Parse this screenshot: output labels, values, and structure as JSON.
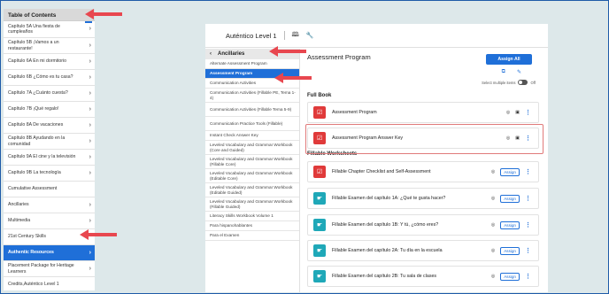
{
  "toc": {
    "title": "Table of Contents",
    "items": [
      {
        "label": "Capítulo 5A Una fiesta de cumpleaños",
        "state": "mark"
      },
      {
        "label": "Capítulo 5B ¡Vamos a un restaurante!",
        "state": ""
      },
      {
        "label": "Capítulo 6A En mi dormitorio",
        "state": ""
      },
      {
        "label": "Capítulo 6B ¿Cómo es tu casa?",
        "state": ""
      },
      {
        "label": "Capítulo 7A ¿Cuánto cuesta?",
        "state": ""
      },
      {
        "label": "Capítulo 7B ¡Qué regalo!",
        "state": ""
      },
      {
        "label": "Capítulo 8A De vacaciones",
        "state": ""
      },
      {
        "label": "Capítulo 8B Ayudando en la comunidad",
        "state": ""
      },
      {
        "label": "Capítulo 9A El cine y la televisión",
        "state": ""
      },
      {
        "label": "Capítulo 9B La tecnología",
        "state": ""
      },
      {
        "label": "Cumulative Assessment",
        "state": "nochev"
      },
      {
        "label": "Ancillaries",
        "state": ""
      },
      {
        "label": "Multimedia",
        "state": ""
      },
      {
        "label": "21st Century Skills",
        "state": "nochev"
      },
      {
        "label": "Authentic Resources",
        "state": "active"
      },
      {
        "label": "Placement Package for Heritage Learners",
        "state": ""
      },
      {
        "label": "Credits,Auténtico Level 1",
        "state": "nochev"
      }
    ]
  },
  "app": {
    "title": "Auténtico Level 1",
    "book_icon": "book-icon",
    "wrench_icon": "wrench-icon",
    "sidebar": {
      "back_label": "Ancillaries",
      "items": [
        {
          "label": "Alternate Assessment Program",
          "active": false
        },
        {
          "label": "Assessment Program",
          "active": true
        },
        {
          "label": "Communication Activities",
          "active": false
        },
        {
          "label": "Communication Activities (Fillable PE, Tema 1-4)",
          "active": false
        },
        {
          "label": "Communication Activities (Fillable Tema 5-9)",
          "active": false
        },
        {
          "label": "Communication Practice Tools (Fillable)",
          "active": false
        },
        {
          "label": "Instant Check Answer Key",
          "active": false
        },
        {
          "label": "Leveled Vocabulary and Grammar Workbook (Core and Guided)",
          "active": false
        },
        {
          "label": "Leveled Vocabulary and Grammar Workbook (Fillable Core)",
          "active": false
        },
        {
          "label": "Leveled Vocabulary and Grammar Workbook (Editable Core)",
          "active": false
        },
        {
          "label": "Leveled Vocabulary and Grammar Workbook (Editable Guided)",
          "active": false
        },
        {
          "label": "Leveled Vocabulary and Grammar Workbook (Fillable Guided)",
          "active": false
        },
        {
          "label": "Literacy Skills Workbook Volume 1",
          "active": false
        },
        {
          "label": "Para hispanohablantes",
          "active": false
        },
        {
          "label": "Para el Examen",
          "active": false
        }
      ]
    },
    "content": {
      "title": "Assessment Program",
      "assign_all": "Assign All",
      "select_multiple": "Select multiple items",
      "toggle_state": "Off",
      "full_book_title": "Full Book",
      "fillable_title": "Fillable Worksheets",
      "assign_label": "Assign",
      "full_book": [
        {
          "label": "Assessment Program",
          "icon": "red"
        },
        {
          "label": "Assessment Program Answer Key",
          "icon": "red"
        }
      ],
      "worksheets": [
        {
          "label": "Fillable Chapter Checklist and Self-Assessment"
        },
        {
          "label": "Fillable Examen del capítulo 1A: ¿Qué te gusta hacer?"
        },
        {
          "label": "Fillable Examen del capítulo 1B: Y tú, ¿cómo eres?"
        },
        {
          "label": "Fillable Examen del capítulo 2A: Tu día en la escuela"
        },
        {
          "label": "Fillable Examen del capítulo 2B: Tu sala de clases"
        }
      ]
    }
  },
  "colors": {
    "background": "#dde8ea",
    "accent": "#1f6fd8",
    "arrow": "#e8474f",
    "pdf_icon": "#e03a3a",
    "worksheet_icon": "#1fa8b8"
  }
}
